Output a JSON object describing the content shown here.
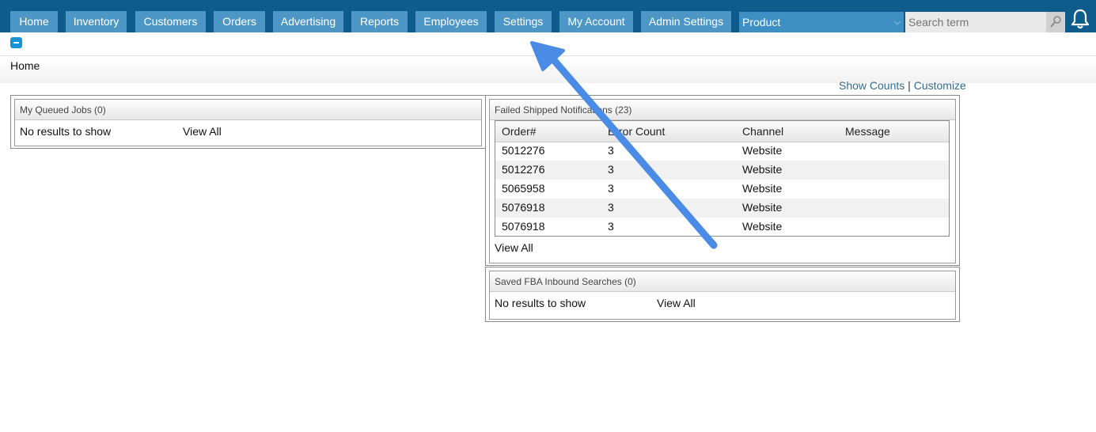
{
  "nav": {
    "tabs": [
      {
        "label": "Home"
      },
      {
        "label": "Inventory"
      },
      {
        "label": "Customers"
      },
      {
        "label": "Orders"
      },
      {
        "label": "Advertising"
      },
      {
        "label": "Reports"
      },
      {
        "label": "Employees"
      },
      {
        "label": "Settings"
      },
      {
        "label": "My Account"
      },
      {
        "label": "Admin Settings"
      }
    ],
    "search_scope": "Product",
    "search_placeholder": "Search term",
    "icons": {
      "search": "magnifier-icon",
      "notifications": "bell-icon"
    }
  },
  "breadcrumb": {
    "current": "Home"
  },
  "top_links": {
    "show_counts": "Show Counts",
    "separator": "|",
    "customize": "Customize"
  },
  "panels": {
    "queued_jobs": {
      "title": "My Queued Jobs (0)",
      "empty_text": "No results to show",
      "view_all": "View All"
    },
    "failed_shipped": {
      "title": "Failed Shipped Notifications (23)",
      "columns": [
        "Order#",
        "Error Count",
        "Channel",
        "Message"
      ],
      "rows": [
        {
          "order": "5012276",
          "errors": "3",
          "channel": "Website",
          "message": ""
        },
        {
          "order": "5012276",
          "errors": "3",
          "channel": "Website",
          "message": ""
        },
        {
          "order": "5065958",
          "errors": "3",
          "channel": "Website",
          "message": ""
        },
        {
          "order": "5076918",
          "errors": "3",
          "channel": "Website",
          "message": ""
        },
        {
          "order": "5076918",
          "errors": "3",
          "channel": "Website",
          "message": ""
        }
      ],
      "view_all": "View All"
    },
    "fba_inbound": {
      "title": "Saved FBA Inbound Searches (0)",
      "empty_text": "No results to show",
      "view_all": "View All"
    }
  },
  "colors": {
    "nav_bar": "#0e5c8c",
    "tab": "#4d97c6",
    "link": "#2f6a93",
    "annotation_arrow": "#4a8be6"
  }
}
